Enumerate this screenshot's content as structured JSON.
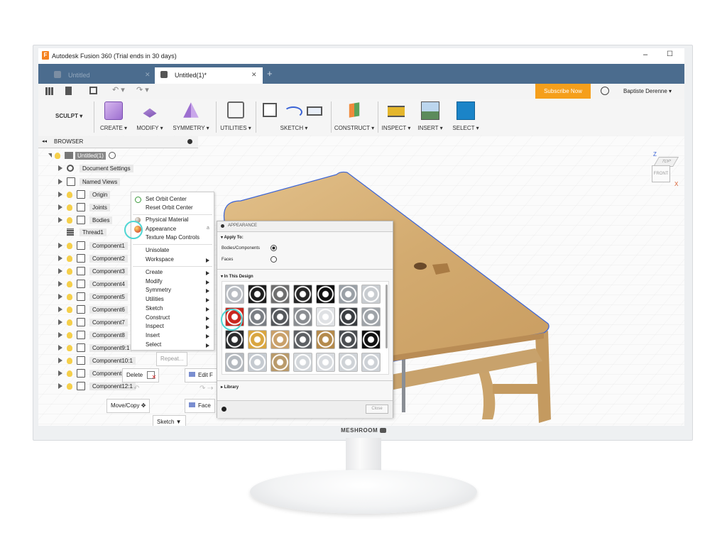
{
  "window": {
    "title": "Autodesk Fusion 360 (Trial ends in 30 days)",
    "minimize": "–",
    "maximize": "☐"
  },
  "tabs": [
    {
      "label": "Untitled",
      "close": "✕"
    },
    {
      "label": "Untitled(1)*",
      "close": "✕"
    }
  ],
  "tab_add": "+",
  "qat": {
    "subscribe": "Subscribe Now",
    "user": "Baptiste Derenne ▾"
  },
  "workspace": {
    "label": "SCULPT ▾"
  },
  "toolbar": {
    "create": "CREATE ▾",
    "modify": "MODIFY ▾",
    "symmetry": "SYMMETRY ▾",
    "utilities": "UTILITIES ▾",
    "sketch": "SKETCH ▾",
    "construct": "CONSTRUCT ▾",
    "inspect": "INSPECT ▾",
    "insert": "INSERT ▾",
    "select": "SELECT ▾"
  },
  "browser": {
    "header": "BROWSER",
    "root": "Untitled(1)",
    "items": [
      "Document Settings",
      "Named Views",
      "Origin",
      "Joints",
      "Bodies",
      "Thread1",
      "Component1",
      "Component2",
      "Component3",
      "Component4",
      "Component5",
      "Component6",
      "Component7",
      "Component8",
      "Component9:1",
      "Component10:1",
      "Component11:1",
      "Component12:1"
    ]
  },
  "context_menu": {
    "items": [
      "Set Orbit Center",
      "Reset Orbit Center",
      "Physical Material",
      "Appearance",
      "Texture Map Controls",
      "Unisolate",
      "Workspace",
      "Create",
      "Modify",
      "Symmetry",
      "Utilities",
      "Sketch",
      "Construct",
      "Inspect",
      "Insert",
      "Select"
    ],
    "appearance_shortcut": "a"
  },
  "marking_menu": {
    "repeat": "Repeat...",
    "delete": "Delete",
    "edit": "Edit F",
    "move_copy": "Move/Copy",
    "face": "Face",
    "sketch": "Sketch ▼"
  },
  "appearance_panel": {
    "title": "APPEARANCE",
    "apply_to": "Apply To:",
    "bodies_components": "Bodies/Components",
    "faces": "Faces",
    "in_this_design": "In This Design",
    "library": "Library",
    "close": "Close",
    "swatch_colors": [
      [
        "#b8bcc2",
        "#1e1e1e",
        "#6e6e6e",
        "#262626",
        "#111111",
        "#9aa0a6",
        "#c8ccd0"
      ],
      [
        "#c8261e",
        "#7a7e84",
        "#55585c",
        "#8a8d91",
        "#dfe1e4",
        "#3a3d41",
        "#9ea3a8"
      ],
      [
        "#2a2b2d",
        "#d9a640",
        "#c9a06a",
        "#5c5f63",
        "#b48a4c",
        "#4a4d51",
        "#101010"
      ],
      [
        "#b4b9bf",
        "#c5cad0",
        "#b99a6b",
        "#d2d6da",
        "#d8dbdf",
        "#cfd3d7",
        "#cdd1d6"
      ]
    ]
  },
  "viewcube": {
    "top": "TOP",
    "front": "FRONT",
    "axis_z": "Z",
    "axis_x": "X"
  },
  "colors": {
    "titlebar_blue": "#4b6c8e",
    "subscribe_orange": "#f59f1b",
    "wood": "#d8b47c",
    "selection_edge": "#3a63d6",
    "highlight_ring": "#4fd6d4"
  },
  "monitor_brand": "MESHROOM"
}
